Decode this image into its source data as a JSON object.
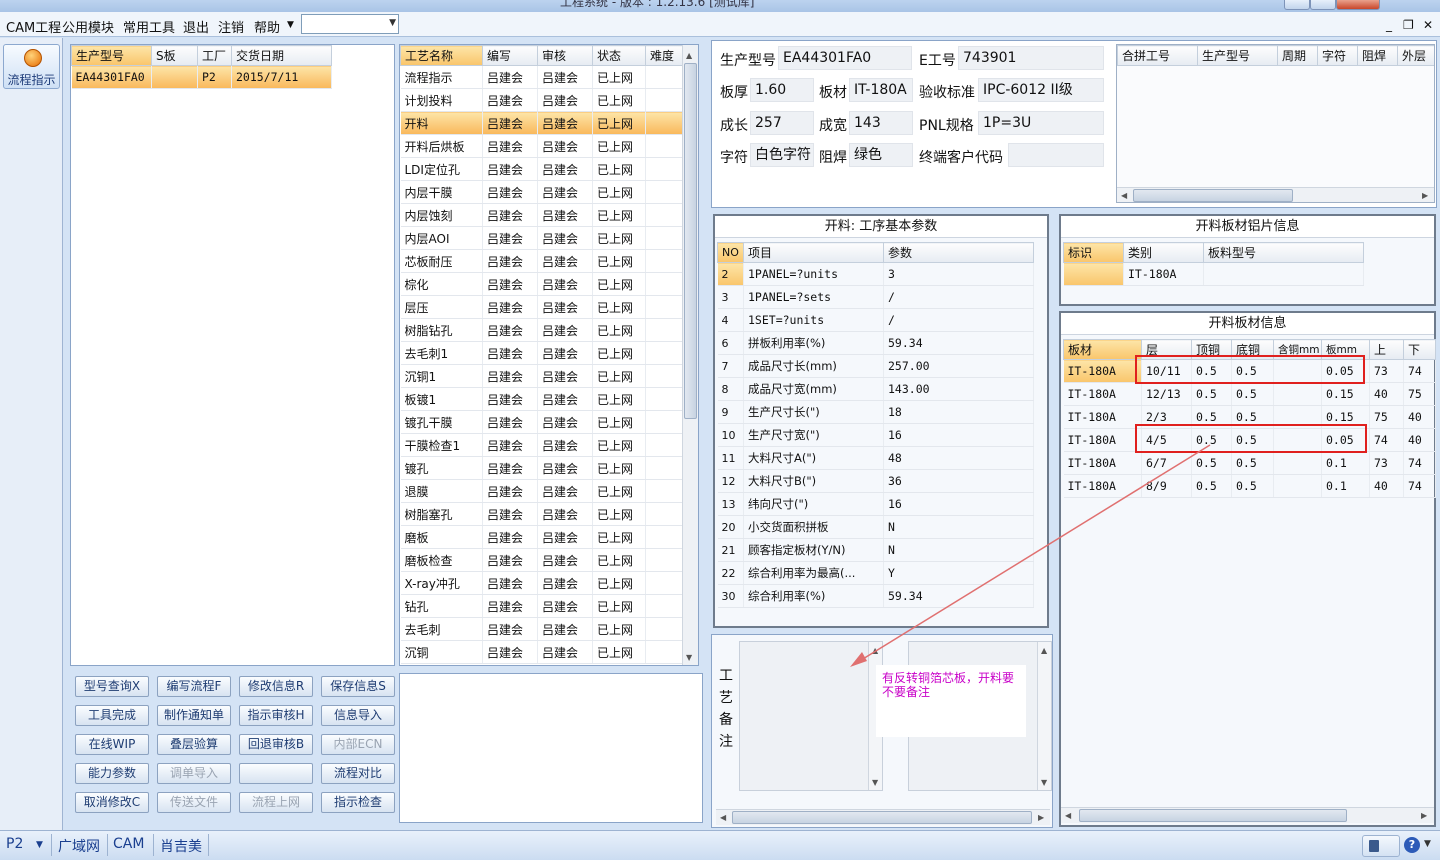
{
  "window": {
    "title": "工程系统 - 版本 : 1.2.13.6 [测试库]"
  },
  "menu": {
    "items": [
      "CAM工程",
      "公用模块",
      "常用工具",
      "退出",
      "注销",
      "帮助"
    ],
    "combo_value": ""
  },
  "sidebar": {
    "flow_button_label": "流程指示"
  },
  "model_list": {
    "columns": [
      "生产型号",
      "S板",
      "工厂",
      "交货日期"
    ],
    "rows": [
      [
        "EA44301FA0",
        "",
        "P2",
        "2015/7/11"
      ]
    ]
  },
  "process_list": {
    "columns": [
      "工艺名称",
      "编写",
      "审核",
      "状态",
      "难度"
    ],
    "selected_index": 2,
    "rows": [
      [
        "流程指示",
        "吕建会",
        "吕建会",
        "已上网",
        ""
      ],
      [
        "计划投料",
        "吕建会",
        "吕建会",
        "已上网",
        ""
      ],
      [
        "开料",
        "吕建会",
        "吕建会",
        "已上网",
        ""
      ],
      [
        "开料后烘板",
        "吕建会",
        "吕建会",
        "已上网",
        ""
      ],
      [
        "LDI定位孔",
        "吕建会",
        "吕建会",
        "已上网",
        ""
      ],
      [
        "内层干膜",
        "吕建会",
        "吕建会",
        "已上网",
        ""
      ],
      [
        "内层蚀刻",
        "吕建会",
        "吕建会",
        "已上网",
        ""
      ],
      [
        "内层AOI",
        "吕建会",
        "吕建会",
        "已上网",
        ""
      ],
      [
        "芯板耐压",
        "吕建会",
        "吕建会",
        "已上网",
        ""
      ],
      [
        "棕化",
        "吕建会",
        "吕建会",
        "已上网",
        ""
      ],
      [
        "层压",
        "吕建会",
        "吕建会",
        "已上网",
        ""
      ],
      [
        "树脂钻孔",
        "吕建会",
        "吕建会",
        "已上网",
        ""
      ],
      [
        "去毛刺1",
        "吕建会",
        "吕建会",
        "已上网",
        ""
      ],
      [
        "沉铜1",
        "吕建会",
        "吕建会",
        "已上网",
        ""
      ],
      [
        "板镀1",
        "吕建会",
        "吕建会",
        "已上网",
        ""
      ],
      [
        "镀孔干膜",
        "吕建会",
        "吕建会",
        "已上网",
        ""
      ],
      [
        "干膜检查1",
        "吕建会",
        "吕建会",
        "已上网",
        ""
      ],
      [
        "镀孔",
        "吕建会",
        "吕建会",
        "已上网",
        ""
      ],
      [
        "退膜",
        "吕建会",
        "吕建会",
        "已上网",
        ""
      ],
      [
        "树脂塞孔",
        "吕建会",
        "吕建会",
        "已上网",
        ""
      ],
      [
        "磨板",
        "吕建会",
        "吕建会",
        "已上网",
        ""
      ],
      [
        "磨板检查",
        "吕建会",
        "吕建会",
        "已上网",
        ""
      ],
      [
        "X-ray冲孔",
        "吕建会",
        "吕建会",
        "已上网",
        ""
      ],
      [
        "钻孔",
        "吕建会",
        "吕建会",
        "已上网",
        ""
      ],
      [
        "去毛刺",
        "吕建会",
        "吕建会",
        "已上网",
        ""
      ],
      [
        "沉铜",
        "吕建会",
        "吕建会",
        "已上网",
        ""
      ]
    ]
  },
  "actions": [
    {
      "label": "型号查询X",
      "enabled": true
    },
    {
      "label": "编写流程F",
      "enabled": true
    },
    {
      "label": "修改信息R",
      "enabled": true
    },
    {
      "label": "保存信息S",
      "enabled": true
    },
    {
      "label": "工具完成",
      "enabled": true
    },
    {
      "label": "制作通知单",
      "enabled": true
    },
    {
      "label": "指示审核H",
      "enabled": true
    },
    {
      "label": "信息导入",
      "enabled": true
    },
    {
      "label": "在线WIP",
      "enabled": true
    },
    {
      "label": "叠层验算",
      "enabled": true
    },
    {
      "label": "回退审核B",
      "enabled": true
    },
    {
      "label": "内部ECN",
      "enabled": false
    },
    {
      "label": "能力参数",
      "enabled": true
    },
    {
      "label": "调单导入",
      "enabled": false
    },
    {
      "label": "",
      "enabled": true
    },
    {
      "label": "流程对比",
      "enabled": true
    },
    {
      "label": "取消修改C",
      "enabled": true
    },
    {
      "label": "传送文件",
      "enabled": false
    },
    {
      "label": "流程上网",
      "enabled": false
    },
    {
      "label": "指示检查",
      "enabled": true
    }
  ],
  "info": {
    "model_label": "生产型号",
    "model_value": "EA44301FA0",
    "eng_label": "E工号",
    "eng_value": "743901",
    "thickness_label": "板厚",
    "thickness_value": "1.60",
    "material_label": "板材",
    "material_value": "IT-180A",
    "standard_label": "验收标准",
    "standard_value": "IPC-6012 II级",
    "length_label": "成长",
    "length_value": "257",
    "width_label": "成宽",
    "width_value": "143",
    "pnl_label": "PNL规格",
    "pnl_value": "1P=3U",
    "char_label": "字符",
    "char_value": "白色字符",
    "mask_label": "阻焊",
    "mask_value": "绿色",
    "customer_label": "终端客户代码",
    "customer_value": ""
  },
  "merge_table": {
    "columns": [
      "合拼工号",
      "生产型号",
      "周期",
      "字符",
      "阻焊",
      "外层"
    ]
  },
  "params": {
    "title": "开料: 工序基本参数",
    "columns": [
      "NO",
      "项目",
      "参数"
    ],
    "rows": [
      [
        "2",
        "1PANEL=?units",
        "3"
      ],
      [
        "3",
        "1PANEL=?sets",
        "/"
      ],
      [
        "4",
        "1SET=?units",
        "/"
      ],
      [
        "6",
        "拼板利用率(%)",
        "59.34"
      ],
      [
        "7",
        "成品尺寸长(mm)",
        "257.00"
      ],
      [
        "8",
        "成品尺寸宽(mm)",
        "143.00"
      ],
      [
        "9",
        "生产尺寸长(\")",
        "18"
      ],
      [
        "10",
        "生产尺寸宽(\")",
        "16"
      ],
      [
        "11",
        "大料尺寸A(\")",
        "48"
      ],
      [
        "12",
        "大料尺寸B(\")",
        "36"
      ],
      [
        "13",
        "纬向尺寸(\")",
        "16"
      ],
      [
        "20",
        "小交货面积拼板",
        "N"
      ],
      [
        "21",
        "顾客指定板材(Y/N)",
        "N"
      ],
      [
        "22",
        "综合利用率为最高(...",
        "Y"
      ],
      [
        "30",
        "综合利用率(%)",
        "59.34"
      ]
    ]
  },
  "sheet_info": {
    "title": "开料板材铝片信息",
    "columns": [
      "标识",
      "类别",
      "板料型号"
    ],
    "rows": [
      [
        "",
        "IT-180A",
        ""
      ]
    ]
  },
  "material_info": {
    "title": "开料板材信息",
    "columns": [
      "板材",
      "层",
      "顶铜",
      "底铜",
      "含铜mm",
      "板mm",
      "上",
      "下"
    ],
    "rows": [
      [
        "IT-180A",
        "10/11",
        "0.5",
        "0.5",
        "",
        "0.05",
        "73",
        "74"
      ],
      [
        "IT-180A",
        "12/13",
        "0.5",
        "0.5",
        "",
        "0.15",
        "40",
        "75"
      ],
      [
        "IT-180A",
        "2/3",
        "0.5",
        "0.5",
        "",
        "0.15",
        "75",
        "40"
      ],
      [
        "IT-180A",
        "4/5",
        "0.5",
        "0.5",
        "",
        "0.05",
        "74",
        "40"
      ],
      [
        "IT-180A",
        "6/7",
        "0.5",
        "0.5",
        "",
        "0.1",
        "73",
        "74"
      ],
      [
        "IT-180A",
        "8/9",
        "0.5",
        "0.5",
        "",
        "0.1",
        "40",
        "74"
      ]
    ]
  },
  "remarks": {
    "label": "工艺备注",
    "annotation": "有反转铜箔芯板，开料要不要备注"
  },
  "status": {
    "factory": "P2",
    "items": [
      "广域网",
      "CAM",
      "肖吉美"
    ]
  },
  "colors": {
    "accent_selected": "#f9b85b",
    "annotation_text": "#c800c8",
    "highlight_red": "#e0201e"
  }
}
